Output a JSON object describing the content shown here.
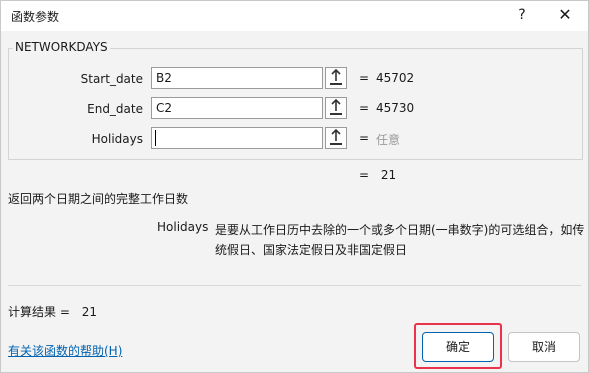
{
  "window": {
    "title": "函数参数",
    "help_glyph": "?",
    "close_glyph": "✕"
  },
  "function": {
    "name": "NETWORKDAYS",
    "args": [
      {
        "label": "Start_date",
        "value": "B2",
        "result": "45702",
        "is_hint": false
      },
      {
        "label": "End_date",
        "value": "C2",
        "result": "45730",
        "is_hint": false
      },
      {
        "label": "Holidays",
        "value": "",
        "result": "任意",
        "is_hint": true
      }
    ],
    "equals": "=",
    "overall_result": "21",
    "description": "返回两个日期之间的完整工作日数",
    "arg_desc_name": "Holidays",
    "arg_desc_text": "是要从工作日历中去除的一个或多个日期(一串数字)的可选组合，如传统假日、国家法定假日及非国定假日"
  },
  "footer": {
    "calc_result_label": "计算结果 =",
    "calc_result_value": "21",
    "help_link": "有关该函数的帮助(H)",
    "ok_label": "确定",
    "cancel_label": "取消"
  },
  "colors": {
    "highlight": "#e8334a",
    "link": "#0063b1"
  }
}
